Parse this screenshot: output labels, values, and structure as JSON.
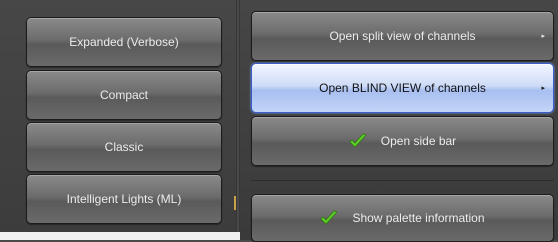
{
  "left_panel": {
    "buttons": [
      {
        "label": "Expanded (Verbose)"
      },
      {
        "label": "Compact"
      },
      {
        "label": "Classic"
      },
      {
        "label": "Intelligent Lights (ML)"
      }
    ]
  },
  "right_panel": {
    "buttons": [
      {
        "label": "Open split view of channels",
        "has_submenu": true,
        "arrow_icon": "▸"
      },
      {
        "label": "Open BLIND VIEW of channels",
        "has_submenu": true,
        "selected": true,
        "arrow_icon": "▸"
      },
      {
        "label": "Open side bar",
        "checked": true,
        "icon": "checkmark-icon"
      },
      {
        "label": "Show palette information",
        "checked": true,
        "icon": "checkmark-icon"
      }
    ]
  },
  "colors": {
    "background": "#4a4a4a",
    "button": "#6c6c6c",
    "selected": "#cfdcf7",
    "selected_border": "#3a5fcc",
    "check": "#5fcf2a"
  }
}
